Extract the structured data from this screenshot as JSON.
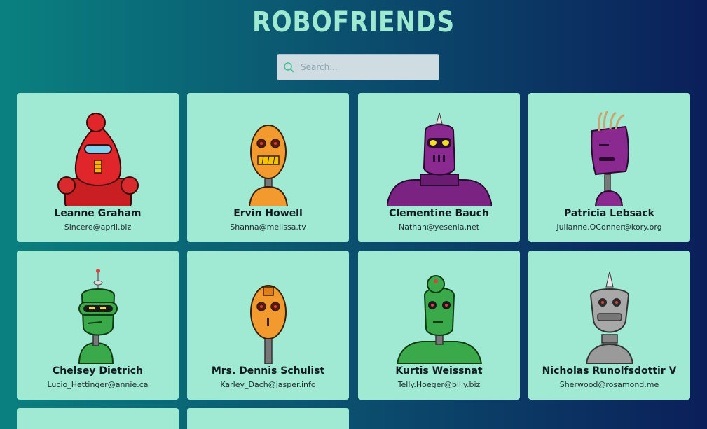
{
  "app": {
    "title": "ROBOFRIENDS"
  },
  "search": {
    "placeholder": "Search...",
    "value": ""
  },
  "robots": [
    {
      "name": "Leanne Graham",
      "email": "Sincere@april.biz",
      "color": "#e0262a"
    },
    {
      "name": "Ervin Howell",
      "email": "Shanna@melissa.tv",
      "color": "#f29a2e"
    },
    {
      "name": "Clementine Bauch",
      "email": "Nathan@yesenia.net",
      "color": "#8a2a91"
    },
    {
      "name": "Patricia Lebsack",
      "email": "Julianne.OConner@kory.org",
      "color": "#8a2a91"
    },
    {
      "name": "Chelsey Dietrich",
      "email": "Lucio_Hettinger@annie.ca",
      "color": "#3aa94a"
    },
    {
      "name": "Mrs. Dennis Schulist",
      "email": "Karley_Dach@jasper.info",
      "color": "#f29a2e"
    },
    {
      "name": "Kurtis Weissnat",
      "email": "Telly.Hoeger@billy.biz",
      "color": "#3aa94a"
    },
    {
      "name": "Nicholas Runolfsdottir V",
      "email": "Sherwood@rosamond.me",
      "color": "#9a9a9a"
    }
  ],
  "colors": {
    "card_bg": "#a0ead3",
    "title": "#9fe9d0",
    "search_bg": "#cfdde3"
  },
  "icons": {
    "search": "search-icon"
  }
}
